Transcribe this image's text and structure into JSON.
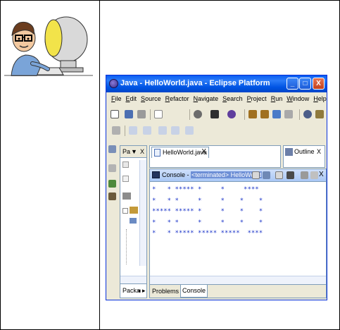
{
  "window": {
    "title": "Java - HelloWorld.java - Eclipse Platform",
    "minimize": "_",
    "maximize": "□",
    "close": "X"
  },
  "menu": [
    "File",
    "Edit",
    "Source",
    "Refactor",
    "Navigate",
    "Search",
    "Project",
    "Run",
    "Window",
    "Help"
  ],
  "package_explorer": {
    "tab_label": "Pa",
    "dropdown": "▼",
    "close": "X",
    "bottom_label": "Packa",
    "bottom_arrows": "◂ ▸"
  },
  "editor": {
    "tab_label": "HelloWorld.java",
    "close": "X"
  },
  "outline": {
    "tab_label": "Outline",
    "close": "X"
  },
  "console": {
    "title": "Console - ",
    "title_highlight": "<terminated> HelloWorld",
    "close": "X",
    "output": "*   * ***** *     *     ****\n*   * *     *     *    *    *\n***** ***** *     *    *    *\n*   * *     *     *    *    *\n*   * ***** ***** *****  ****"
  },
  "bottom_tabs": {
    "problems": "Problems",
    "console": "Console"
  },
  "colors": {
    "titlebar": "#0054e3",
    "console_text": "#1a34c8",
    "chrome": "#ece9d8"
  }
}
